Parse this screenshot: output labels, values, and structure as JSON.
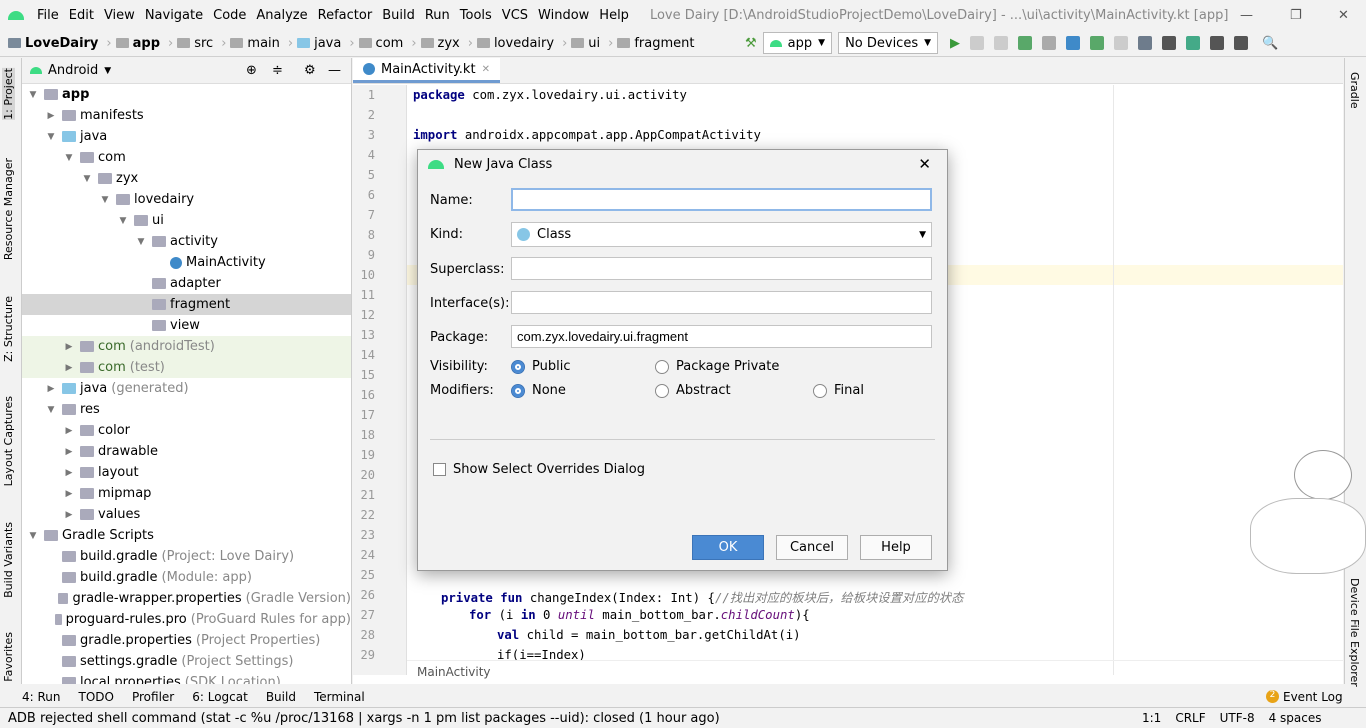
{
  "menu": {
    "items": [
      "File",
      "Edit",
      "View",
      "Navigate",
      "Code",
      "Analyze",
      "Refactor",
      "Build",
      "Run",
      "Tools",
      "VCS",
      "Window",
      "Help"
    ],
    "title": "Love Dairy [D:\\AndroidStudioProjectDemo\\LoveDairy] - ...\\ui\\activity\\MainActivity.kt [app]"
  },
  "breadcrumb": [
    "LoveDairy",
    "app",
    "src",
    "main",
    "java",
    "com",
    "zyx",
    "lovedairy",
    "ui",
    "fragment"
  ],
  "toolbar": {
    "config": "app",
    "device": "No Devices"
  },
  "left_tabs": [
    "1: Project",
    "Resource Manager",
    "Z: Structure",
    "Layout Captures",
    "Build Variants",
    "Favorites"
  ],
  "right_tabs": [
    "Gradle",
    "Device File Explorer"
  ],
  "project": {
    "view": "Android",
    "tree": [
      {
        "label": "app",
        "depth": 0,
        "arrow": "▼",
        "bold": true
      },
      {
        "label": "manifests",
        "depth": 1,
        "arrow": "▶"
      },
      {
        "label": "java",
        "depth": 1,
        "arrow": "▼"
      },
      {
        "label": "com",
        "depth": 2,
        "arrow": "▼"
      },
      {
        "label": "zyx",
        "depth": 3,
        "arrow": "▼"
      },
      {
        "label": "lovedairy",
        "depth": 4,
        "arrow": "▼"
      },
      {
        "label": "ui",
        "depth": 5,
        "arrow": "▼"
      },
      {
        "label": "activity",
        "depth": 6,
        "arrow": "▼"
      },
      {
        "label": "MainActivity",
        "depth": 7,
        "arrow": ""
      },
      {
        "label": "adapter",
        "depth": 6,
        "arrow": ""
      },
      {
        "label": "fragment",
        "depth": 6,
        "arrow": "",
        "selected": true
      },
      {
        "label": "view",
        "depth": 6,
        "arrow": ""
      },
      {
        "label": "com",
        "depth": 2,
        "arrow": "▶",
        "note": "(androidTest)",
        "test": true
      },
      {
        "label": "com",
        "depth": 2,
        "arrow": "▶",
        "note": "(test)",
        "test": true
      },
      {
        "label": "java",
        "depth": 1,
        "arrow": "▶",
        "note": "(generated)"
      },
      {
        "label": "res",
        "depth": 1,
        "arrow": "▼"
      },
      {
        "label": "color",
        "depth": 2,
        "arrow": "▶"
      },
      {
        "label": "drawable",
        "depth": 2,
        "arrow": "▶"
      },
      {
        "label": "layout",
        "depth": 2,
        "arrow": "▶"
      },
      {
        "label": "mipmap",
        "depth": 2,
        "arrow": "▶"
      },
      {
        "label": "values",
        "depth": 2,
        "arrow": "▶"
      },
      {
        "label": "Gradle Scripts",
        "depth": 0,
        "arrow": "▼"
      },
      {
        "label": "build.gradle",
        "depth": 1,
        "arrow": "",
        "note": "(Project: Love Dairy)"
      },
      {
        "label": "build.gradle",
        "depth": 1,
        "arrow": "",
        "note": "(Module: app)"
      },
      {
        "label": "gradle-wrapper.properties",
        "depth": 1,
        "arrow": "",
        "note": "(Gradle Version)"
      },
      {
        "label": "proguard-rules.pro",
        "depth": 1,
        "arrow": "",
        "note": "(ProGuard Rules for app)"
      },
      {
        "label": "gradle.properties",
        "depth": 1,
        "arrow": "",
        "note": "(Project Properties)"
      },
      {
        "label": "settings.gradle",
        "depth": 1,
        "arrow": "",
        "note": "(Project Settings)"
      },
      {
        "label": "local.properties",
        "depth": 1,
        "arrow": "",
        "note": "(SDK Location)"
      }
    ]
  },
  "editor": {
    "tab": "MainActivity.kt",
    "breadcrumb": "MainActivity",
    "line_numbers": [
      1,
      2,
      3,
      4,
      5,
      6,
      7,
      8,
      9,
      10,
      11,
      12,
      13,
      14,
      15,
      16,
      17,
      18,
      19,
      20,
      21,
      22,
      23,
      24,
      25,
      26,
      27,
      28,
      29
    ],
    "line1_kw": "package",
    "line1_rest": " com.zyx.lovedairy.ui.activity",
    "line3_kw": "import",
    "line3_rest": " androidx.appcompat.app.AppCompatActivity",
    "line26_kw": "private fun",
    "line26_rest": " changeIndex(Index: Int) {",
    "line26_comment": "//找出对应的板块后，给板块设置对应的状态",
    "line27_kw": "for",
    "line27_a": " (i ",
    "line27_in": "in",
    "line27_b": " 0 ",
    "line27_until": "until",
    "line27_c": " main_bottom_bar.",
    "line27_prop": "childCount",
    "line27_d": "){",
    "line28_kw": "val",
    "line28_rest": " child = main_bottom_bar.getChildAt(i)",
    "line29": "if(i==Index)"
  },
  "dialog": {
    "title": "New Java Class",
    "name_label": "Name:",
    "name_value": "",
    "kind_label": "Kind:",
    "kind_value": "Class",
    "superclass_label": "Superclass:",
    "interfaces_label": "Interface(s):",
    "package_label": "Package:",
    "package_value": "com.zyx.lovedairy.ui.fragment",
    "visibility_label": "Visibility:",
    "visibility_options": [
      "Public",
      "Package Private"
    ],
    "visibility_selected": "Public",
    "modifiers_label": "Modifiers:",
    "modifier_options": [
      "None",
      "Abstract",
      "Final"
    ],
    "modifier_selected": "None",
    "overrides_label": "Show Select Overrides Dialog",
    "overrides_checked": false,
    "ok": "OK",
    "cancel": "Cancel",
    "help": "Help"
  },
  "bottom_tabs": [
    "4: Run",
    "TODO",
    "Profiler",
    "6: Logcat",
    "Build",
    "Terminal"
  ],
  "event_log": {
    "count": "2",
    "label": "Event Log"
  },
  "status": {
    "message": "ADB rejected shell command (stat -c %u /proc/13168 | xargs -n 1 pm list packages --uid): closed (1 hour ago)",
    "position": "1:1",
    "line_sep": "CRLF",
    "encoding": "UTF-8",
    "indent": "4 spaces"
  },
  "colors": {
    "accent": "#4a8ad3",
    "android": "#3ddc84",
    "keyword": "#000080"
  }
}
